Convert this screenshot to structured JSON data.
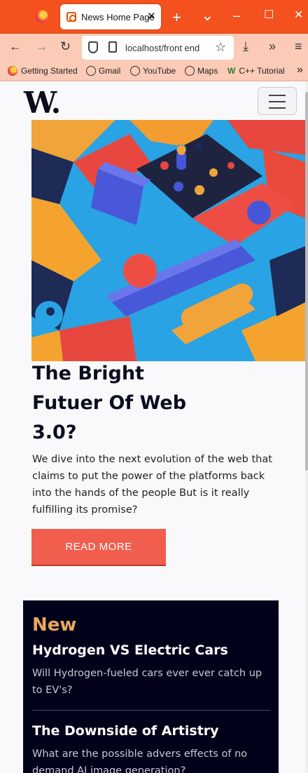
{
  "browser": {
    "tab_title": "News Home Page",
    "tab_close": "✕",
    "new_tab": "+",
    "tab_list": "⌄",
    "minimize": "–",
    "maximize": "☐",
    "close": "✕",
    "back": "←",
    "forward": "→",
    "reload": "↻",
    "url": "localhost/front end",
    "bookmark_star": "☆",
    "downloads": "⤓",
    "more_tools": "»",
    "app_menu": "≡",
    "bookmarks": [
      {
        "label": "Getting Started",
        "icon": "firefox-icon"
      },
      {
        "label": "Gmail",
        "icon": "globe-icon"
      },
      {
        "label": "YouTube",
        "icon": "globe-icon"
      },
      {
        "label": "Maps",
        "icon": "globe-icon"
      },
      {
        "label": "C++ Tutorial",
        "icon": "w3-icon"
      }
    ],
    "bookmarks_overflow": "»"
  },
  "site": {
    "logo": "W.",
    "hero": {
      "headline": "The Bright Futuer Of Web 3.0?",
      "excerpt": "We dive into the next evolution of the web that claims to put the power of the platforms back into the hands of the people But is it really fulfilling its promise?",
      "cta": "READ MORE"
    },
    "new_section": {
      "title": "New",
      "items": [
        {
          "title": "Hydrogen VS Electric Cars",
          "desc": "Will Hydrogen-fueled cars ever ever catch up to EV's?"
        },
        {
          "title": "The Downside of Artistry",
          "desc": "What are the possible advers effects of no demand AI image generation?"
        }
      ]
    }
  },
  "colors": {
    "accent": "#f15e4e",
    "dark": "#01021a",
    "new_title": "#e8a65d",
    "browser_chrome": "#f4511e"
  }
}
